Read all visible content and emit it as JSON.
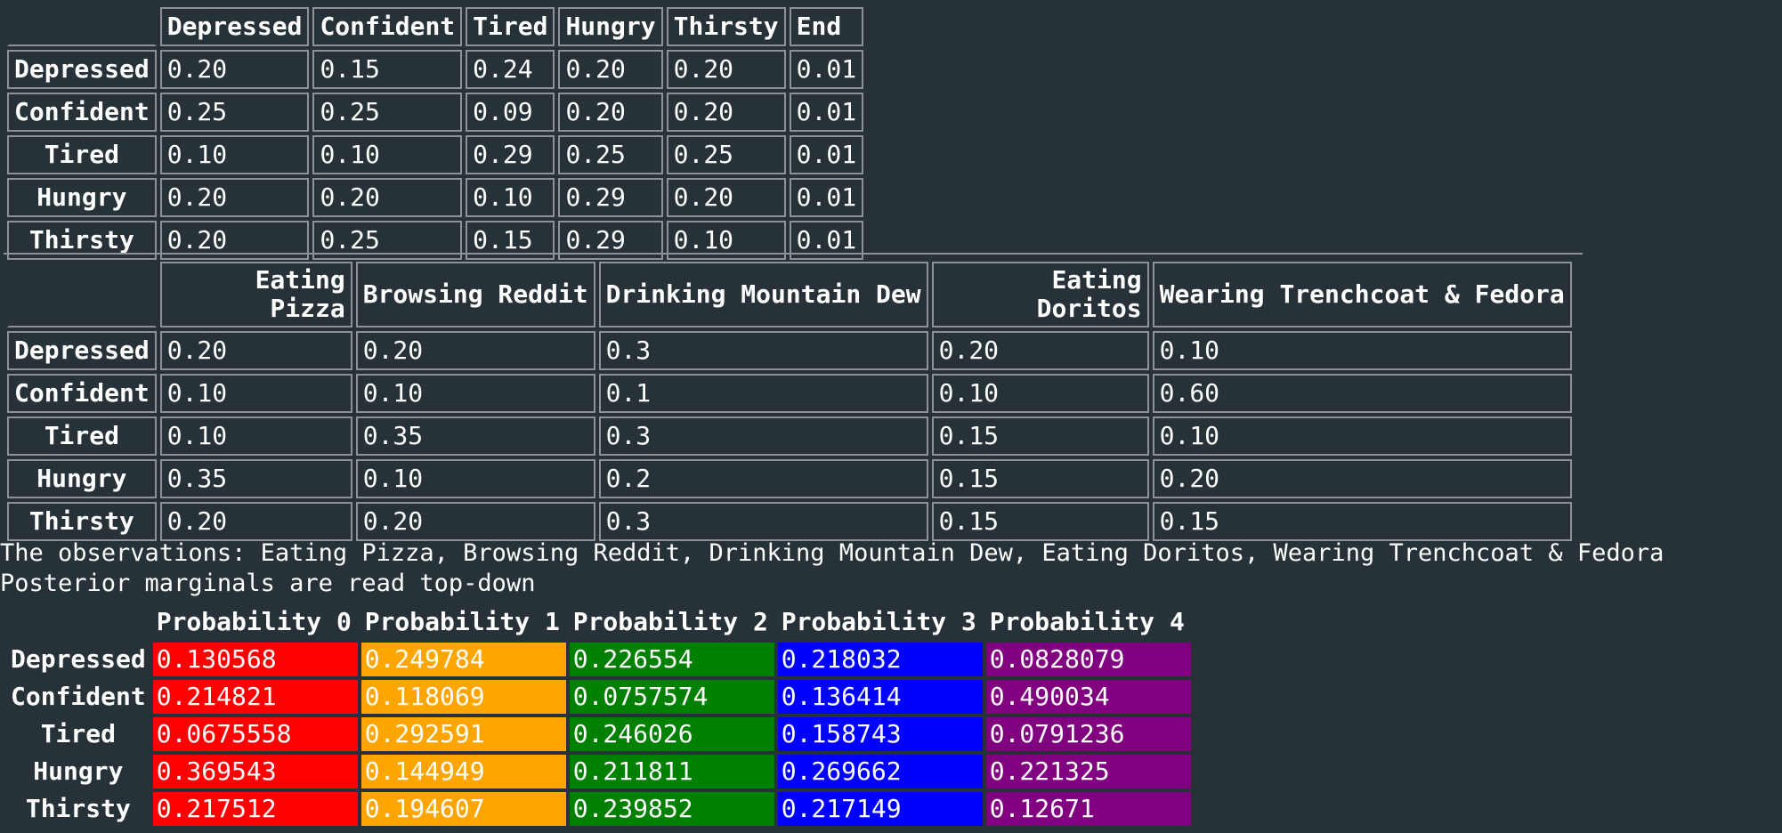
{
  "transition_table": {
    "columns": [
      "Depressed",
      "Confident",
      "Tired",
      "Hungry",
      "Thirsty",
      "End"
    ],
    "rows": [
      {
        "label": "Depressed",
        "values": [
          "0.20",
          "0.15",
          "0.24",
          "0.20",
          "0.20",
          "0.01"
        ]
      },
      {
        "label": "Confident",
        "values": [
          "0.25",
          "0.25",
          "0.09",
          "0.20",
          "0.20",
          "0.01"
        ]
      },
      {
        "label": "Tired",
        "values": [
          "0.10",
          "0.10",
          "0.29",
          "0.25",
          "0.25",
          "0.01"
        ]
      },
      {
        "label": "Hungry",
        "values": [
          "0.20",
          "0.20",
          "0.10",
          "0.29",
          "0.20",
          "0.01"
        ]
      },
      {
        "label": "Thirsty",
        "values": [
          "0.20",
          "0.25",
          "0.15",
          "0.29",
          "0.10",
          "0.01"
        ]
      }
    ]
  },
  "emission_table": {
    "columns": [
      "Eating Pizza",
      "Browsing Reddit",
      "Drinking Mountain Dew",
      "Eating Doritos",
      "Wearing Trenchcoat & Fedora"
    ],
    "rows": [
      {
        "label": "Depressed",
        "values": [
          "0.20",
          "0.20",
          "0.3",
          "0.20",
          "0.10"
        ]
      },
      {
        "label": "Confident",
        "values": [
          "0.10",
          "0.10",
          "0.1",
          "0.10",
          "0.60"
        ]
      },
      {
        "label": "Tired",
        "values": [
          "0.10",
          "0.35",
          "0.3",
          "0.15",
          "0.10"
        ]
      },
      {
        "label": "Hungry",
        "values": [
          "0.35",
          "0.10",
          "0.2",
          "0.15",
          "0.20"
        ]
      },
      {
        "label": "Thirsty",
        "values": [
          "0.20",
          "0.20",
          "0.3",
          "0.15",
          "0.15"
        ]
      }
    ]
  },
  "observations_line": "The observations: Eating Pizza, Browsing Reddit, Drinking Mountain Dew, Eating Doritos, Wearing Trenchcoat & Fedora",
  "posterior_line": "Posterior marginals are read top-down",
  "posterior_table": {
    "columns": [
      "Probability 0",
      "Probability 1",
      "Probability 2",
      "Probability 3",
      "Probability 4"
    ],
    "column_colors": [
      "#ff0000",
      "#ffa500",
      "#008000",
      "#0000ff",
      "#800080"
    ],
    "rows": [
      {
        "label": "Depressed",
        "values": [
          "0.130568",
          "0.249784",
          "0.226554",
          "0.218032",
          "0.0828079"
        ]
      },
      {
        "label": "Confident",
        "values": [
          "0.214821",
          "0.118069",
          "0.0757574",
          "0.136414",
          "0.490034"
        ]
      },
      {
        "label": "Tired",
        "values": [
          "0.0675558",
          "0.292591",
          "0.246026",
          "0.158743",
          "0.0791236"
        ]
      },
      {
        "label": "Hungry",
        "values": [
          "0.369543",
          "0.144949",
          "0.211811",
          "0.269662",
          "0.221325"
        ]
      },
      {
        "label": "Thirsty",
        "values": [
          "0.217512",
          "0.194607",
          "0.239852",
          "0.217149",
          "0.12671"
        ]
      }
    ]
  }
}
